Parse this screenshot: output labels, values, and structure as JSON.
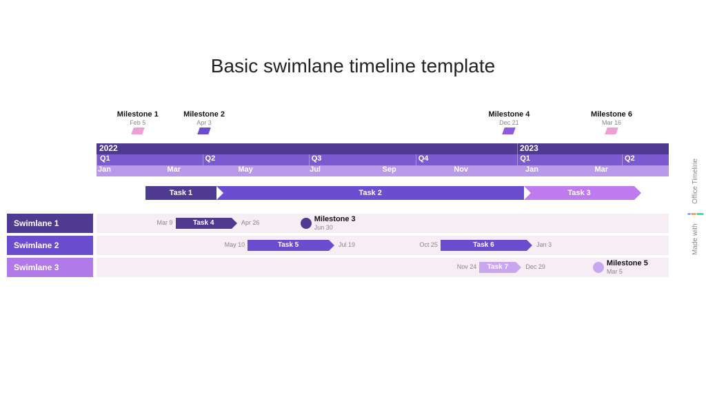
{
  "title": "Basic swimlane timeline template",
  "branding": {
    "made_with": "Made with",
    "product": "Office Timeline"
  },
  "colors": {
    "dark_purple": "#4f3a91",
    "purple": "#6a4ecf",
    "violet": "#8e5be0",
    "light_purple": "#b07ae8",
    "pink": "#ee9fd3",
    "lilac": "#c9a7f0"
  },
  "axis": {
    "years": [
      {
        "label": "2022",
        "pos": 0
      },
      {
        "label": "2023",
        "pos": 73.5
      }
    ],
    "quarters": [
      {
        "label": "Q1",
        "pos": 0
      },
      {
        "label": "Q2",
        "pos": 18.4
      },
      {
        "label": "Q3",
        "pos": 37
      },
      {
        "label": "Q4",
        "pos": 55.7
      },
      {
        "label": "Q1",
        "pos": 73.5
      },
      {
        "label": "Q2",
        "pos": 91.8
      }
    ],
    "months": [
      {
        "label": "Jan",
        "pos": 0
      },
      {
        "label": "Mar",
        "pos": 12.1
      },
      {
        "label": "May",
        "pos": 24.5
      },
      {
        "label": "Jul",
        "pos": 37
      },
      {
        "label": "Sep",
        "pos": 49.7
      },
      {
        "label": "Nov",
        "pos": 62.2
      },
      {
        "label": "Jan",
        "pos": 74.7
      },
      {
        "label": "Mar",
        "pos": 86.8
      }
    ]
  },
  "milestones_top": [
    {
      "label": "Milestone 1",
      "date": "Feb 5",
      "pos": 7.2,
      "color": "#ee9fd3"
    },
    {
      "label": "Milestone 2",
      "date": "Apr 3",
      "pos": 18.8,
      "color": "#6a4ecf"
    },
    {
      "label": "Milestone 4",
      "date": "Dec 21",
      "pos": 72.1,
      "color": "#8e5be0"
    },
    {
      "label": "Milestone 6",
      "date": "Mar 16",
      "pos": 90,
      "color": "#ee9fd3"
    }
  ],
  "tasks_top": [
    {
      "label": "Task 1",
      "start": 8.5,
      "end": 21,
      "color": "#4f3a91"
    },
    {
      "label": "Task 2",
      "start": 21,
      "end": 74.7,
      "color": "#6a4ecf",
      "notch": true
    },
    {
      "label": "Task 3",
      "start": 74.7,
      "end": 94,
      "color": "#c07af0",
      "notch": true
    }
  ],
  "swimlanes": [
    {
      "label": "Swimlane 1",
      "lbl_color": "#4f3a91",
      "items": [
        {
          "type": "task",
          "label": "Task 4",
          "start": 13.8,
          "end": 23.6,
          "color": "#4f3a91",
          "left_date": "Mar 9",
          "right_date": "Apr 26"
        },
        {
          "type": "milestone",
          "label": "Milestone 3",
          "date": "Jun 30",
          "pos": 36.6,
          "color": "#4f3a91"
        }
      ]
    },
    {
      "label": "Swimlane 2",
      "lbl_color": "#6a4ecf",
      "items": [
        {
          "type": "task",
          "label": "Task 5",
          "start": 26.4,
          "end": 40.6,
          "color": "#6a4ecf",
          "left_date": "May 10",
          "right_date": "Jul 19"
        },
        {
          "type": "task",
          "label": "Task 6",
          "start": 60.1,
          "end": 75.2,
          "color": "#6a4ecf",
          "left_date": "Oct 25",
          "right_date": "Jan 3"
        }
      ]
    },
    {
      "label": "Swimlane 3",
      "lbl_color": "#b07ae8",
      "items": [
        {
          "type": "task",
          "label": "Task 7",
          "start": 66.9,
          "end": 73.3,
          "color": "#c9a7f0",
          "left_date": "Nov 24",
          "right_date": "Dec 29"
        },
        {
          "type": "milestone",
          "label": "Milestone 5",
          "date": "Mar 5",
          "pos": 87.7,
          "color": "#c9a7f0"
        }
      ]
    }
  ],
  "chart_data": {
    "type": "gantt",
    "title": "Basic swimlane timeline template",
    "time_range": [
      "2022-01-01",
      "2023-05-08"
    ],
    "milestones": [
      {
        "name": "Milestone 1",
        "date": "2022-02-05",
        "lane": null
      },
      {
        "name": "Milestone 2",
        "date": "2022-04-03",
        "lane": null
      },
      {
        "name": "Milestone 3",
        "date": "2022-06-30",
        "lane": "Swimlane 1"
      },
      {
        "name": "Milestone 4",
        "date": "2022-12-21",
        "lane": null
      },
      {
        "name": "Milestone 5",
        "date": "2023-03-05",
        "lane": "Swimlane 3"
      },
      {
        "name": "Milestone 6",
        "date": "2023-03-16",
        "lane": null
      }
    ],
    "tasks": [
      {
        "name": "Task 1",
        "lane": null,
        "start": "2022-02-10",
        "end": "2022-04-12"
      },
      {
        "name": "Task 2",
        "lane": null,
        "start": "2022-04-12",
        "end": "2023-01-05"
      },
      {
        "name": "Task 3",
        "lane": null,
        "start": "2023-01-05",
        "end": "2023-04-08"
      },
      {
        "name": "Task 4",
        "lane": "Swimlane 1",
        "start": "2022-03-09",
        "end": "2022-04-26"
      },
      {
        "name": "Task 5",
        "lane": "Swimlane 2",
        "start": "2022-05-10",
        "end": "2022-07-19"
      },
      {
        "name": "Task 6",
        "lane": "Swimlane 2",
        "start": "2022-10-25",
        "end": "2023-01-03"
      },
      {
        "name": "Task 7",
        "lane": "Swimlane 3",
        "start": "2022-11-24",
        "end": "2022-12-29"
      }
    ],
    "swimlanes": [
      "Swimlane 1",
      "Swimlane 2",
      "Swimlane 3"
    ]
  }
}
